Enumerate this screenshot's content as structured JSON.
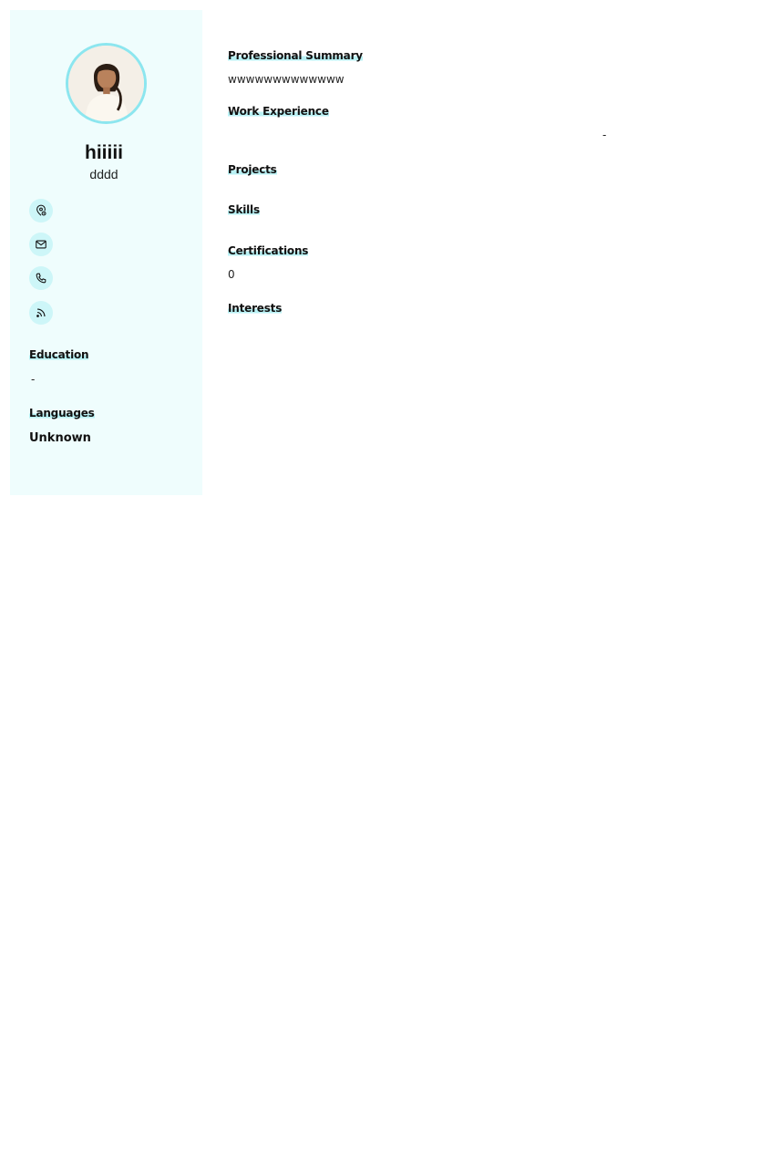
{
  "profile": {
    "name": "hiiiii",
    "title": "dddd",
    "avatar": "profile-photo"
  },
  "contacts": [
    {
      "icon": "location-icon"
    },
    {
      "icon": "mail-icon"
    },
    {
      "icon": "phone-icon"
    },
    {
      "icon": "rss-icon"
    }
  ],
  "sidebar": {
    "education_heading": "Education",
    "education_value": "-",
    "languages_heading": "Languages",
    "languages_value": "Unknown"
  },
  "main": {
    "summary_heading": "Professional Summary",
    "summary_text": "wwwwwwwwwwwww",
    "experience_heading": "Work Experience",
    "experience_dash": "-",
    "projects_heading": "Projects",
    "skills_heading": "Skills",
    "certifications_heading": "Certifications",
    "certifications_value": "0",
    "interests_heading": "Interests"
  },
  "colors": {
    "sidebar_bg": "#effdfd",
    "accent": "#8ce6ef",
    "highlight": "#b9f1f4",
    "icon_bg": "#cdf6f8"
  }
}
